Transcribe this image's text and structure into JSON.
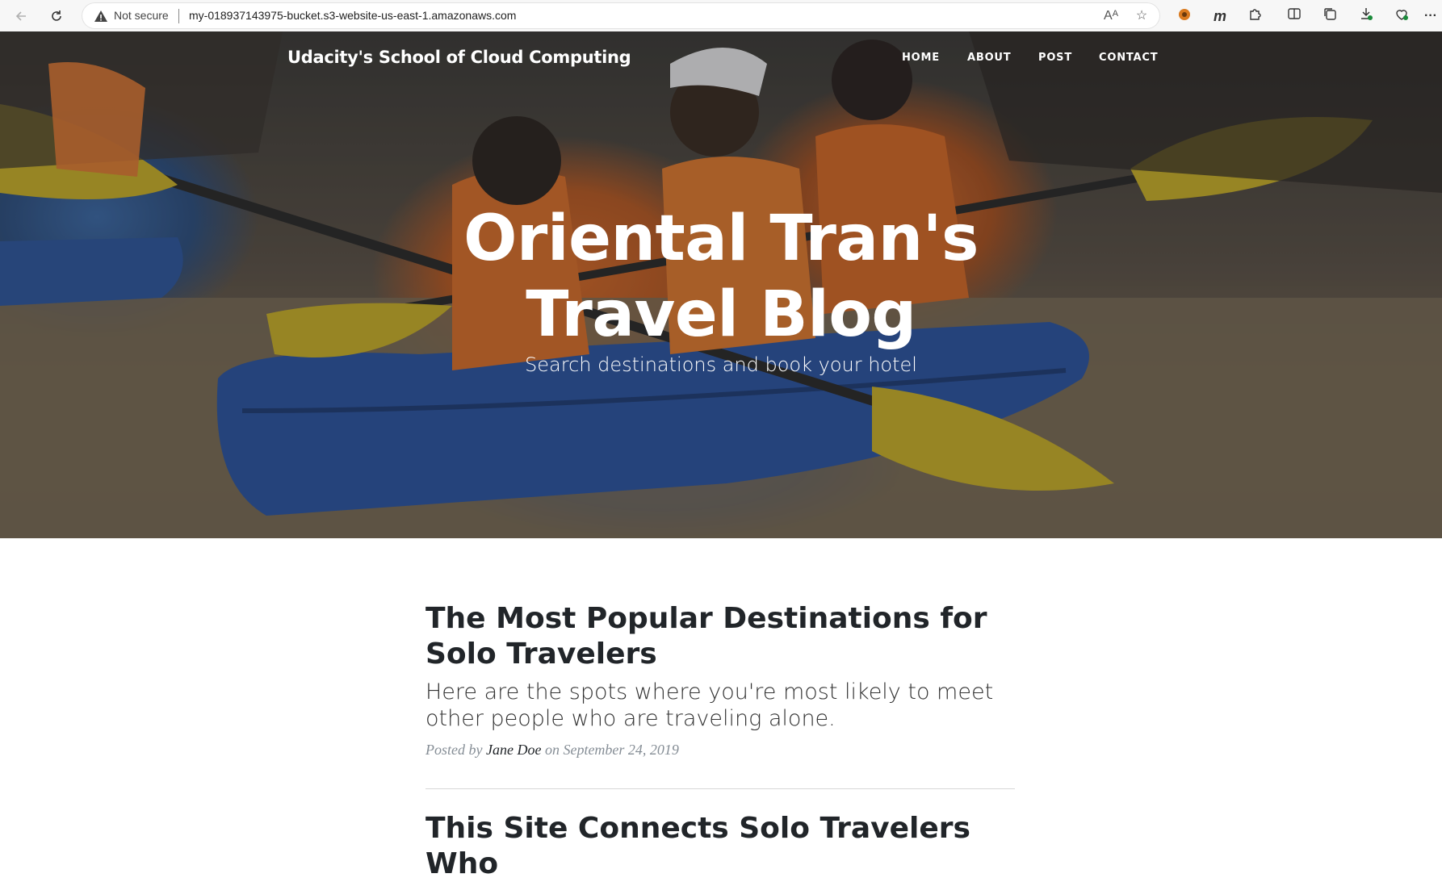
{
  "browser": {
    "security_label": "Not secure",
    "url": "my-018937143975-bucket.s3-website-us-east-1.amazonaws.com",
    "icons": [
      "back-icon",
      "reload-icon",
      "warning-icon",
      "read-aloud-icon",
      "favorite-star-icon",
      "extension-icon",
      "m-extension-icon",
      "puzzle-icon",
      "split-screen-icon",
      "collections-icon",
      "downloads-icon",
      "browser-essentials-icon",
      "more-icon"
    ]
  },
  "site": {
    "brand": "Udacity's School of Cloud Computing",
    "nav": [
      "HOME",
      "ABOUT",
      "POST",
      "CONTACT"
    ]
  },
  "hero": {
    "title_line1": "Oriental Tran's",
    "title_line2": "Travel Blog",
    "subtitle": "Search destinations and book your hotel"
  },
  "posts": [
    {
      "title": "The Most Popular Destinations for Solo Travelers",
      "subtitle": "Here are the spots where you're most likely to meet other people who are traveling alone.",
      "meta_prefix": "Posted by",
      "author": "Jane Doe",
      "meta_on": "on",
      "date": "September 24, 2019"
    },
    {
      "title": "This Site Connects Solo Travelers Who"
    }
  ]
}
